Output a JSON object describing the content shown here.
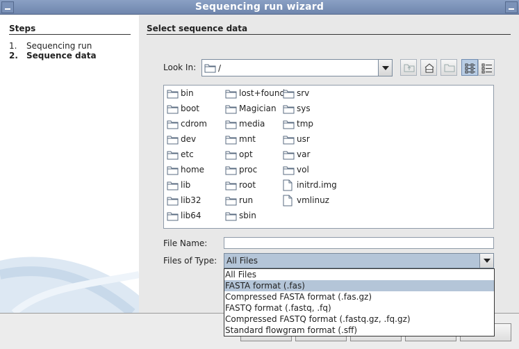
{
  "window": {
    "title": "Sequencing run wizard"
  },
  "steps": {
    "heading": "Steps",
    "items": [
      {
        "num": "1.",
        "label": "Sequencing run"
      },
      {
        "num": "2.",
        "label": "Sequence data"
      }
    ]
  },
  "main": {
    "heading": "Select sequence data",
    "look_in": {
      "label": "Look In:",
      "value": "/"
    },
    "files": [
      {
        "name": "bin",
        "icon": "folder-icon"
      },
      {
        "name": "boot",
        "icon": "folder-icon"
      },
      {
        "name": "cdrom",
        "icon": "folder-icon"
      },
      {
        "name": "dev",
        "icon": "folder-icon"
      },
      {
        "name": "etc",
        "icon": "folder-icon"
      },
      {
        "name": "home",
        "icon": "folder-icon"
      },
      {
        "name": "lib",
        "icon": "folder-icon"
      },
      {
        "name": "lib32",
        "icon": "folder-icon"
      },
      {
        "name": "lib64",
        "icon": "folder-icon"
      },
      {
        "name": "lost+found",
        "icon": "folder-icon"
      },
      {
        "name": "Magician",
        "icon": "folder-icon"
      },
      {
        "name": "media",
        "icon": "folder-icon"
      },
      {
        "name": "mnt",
        "icon": "folder-icon"
      },
      {
        "name": "opt",
        "icon": "folder-icon"
      },
      {
        "name": "proc",
        "icon": "folder-icon"
      },
      {
        "name": "root",
        "icon": "folder-icon"
      },
      {
        "name": "run",
        "icon": "folder-icon"
      },
      {
        "name": "sbin",
        "icon": "folder-icon"
      },
      {
        "name": "srv",
        "icon": "folder-icon"
      },
      {
        "name": "sys",
        "icon": "folder-icon"
      },
      {
        "name": "tmp",
        "icon": "folder-icon"
      },
      {
        "name": "usr",
        "icon": "folder-icon"
      },
      {
        "name": "var",
        "icon": "folder-icon"
      },
      {
        "name": "vol",
        "icon": "folder-icon"
      },
      {
        "name": "initrd.img",
        "icon": "file-icon"
      },
      {
        "name": "vmlinuz",
        "icon": "file-icon"
      }
    ],
    "file_name": {
      "label": "File Name:",
      "value": ""
    },
    "files_of_type": {
      "label": "Files of Type:",
      "selected": "All Files",
      "options": [
        "All Files",
        "FASTA format (.fas)",
        "Compressed FASTA format (.fas.gz)",
        "FASTQ format (.fastq, .fq)",
        "Compressed FASTQ format (.fastq.gz, .fq.gz)",
        "Standard flowgram format (.sff)"
      ],
      "highlighted_index": 1
    }
  },
  "colors": {
    "titlebar": "#7b92b8",
    "selection": "#b4c5d8"
  }
}
